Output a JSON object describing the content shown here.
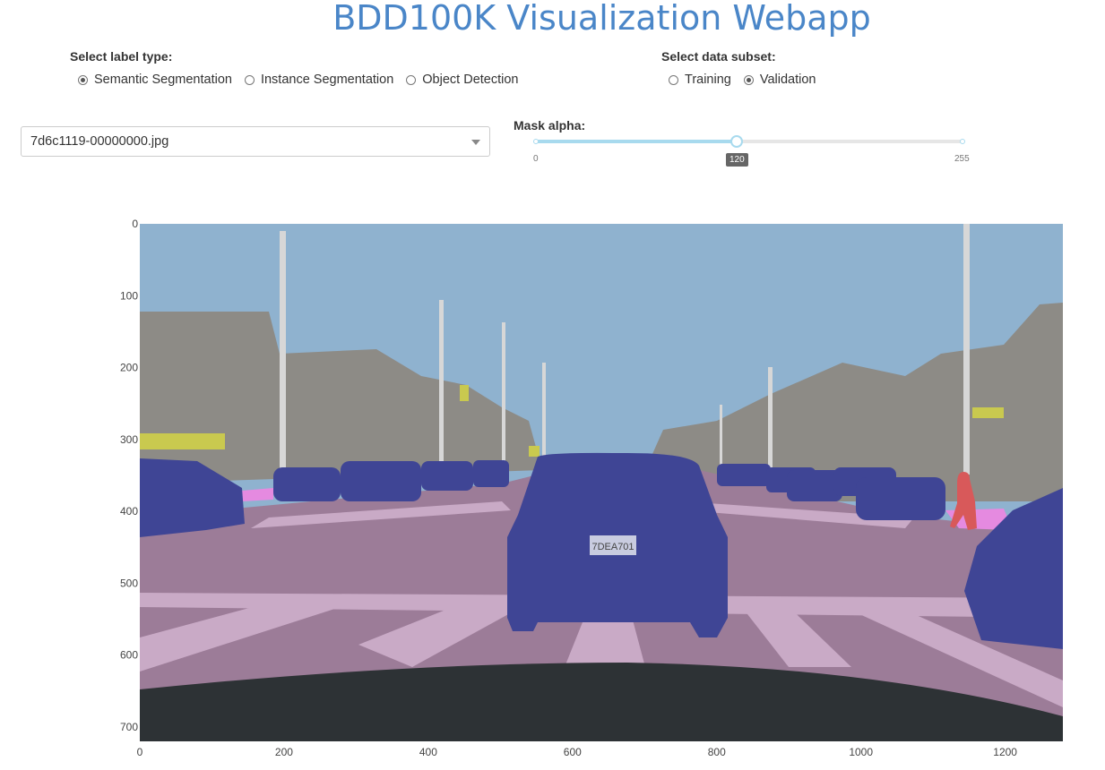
{
  "header": {
    "title": "BDD100K Visualization Webapp"
  },
  "label_type": {
    "label": "Select label type:",
    "options": [
      {
        "label": "Semantic Segmentation",
        "checked": true
      },
      {
        "label": "Instance Segmentation",
        "checked": false
      },
      {
        "label": "Object Detection",
        "checked": false
      }
    ]
  },
  "data_subset": {
    "label": "Select data subset:",
    "options": [
      {
        "label": "Training",
        "checked": false
      },
      {
        "label": "Validation",
        "checked": true
      }
    ]
  },
  "image_select": {
    "value": "7d6c1119-00000000.jpg"
  },
  "mask_alpha": {
    "label": "Mask alpha:",
    "min": 0,
    "max": 255,
    "value": 120,
    "min_label": "0",
    "max_label": "255",
    "value_label": "120"
  },
  "image_plot": {
    "x_ticks": [
      "0",
      "200",
      "400",
      "600",
      "800",
      "1000",
      "1200"
    ],
    "y_ticks": [
      "0",
      "100",
      "200",
      "300",
      "400",
      "500",
      "600",
      "700"
    ],
    "plate_text": "7DEA701",
    "colors": {
      "sky": "#8fb2cf",
      "road": "#9c7c98",
      "crosswalk": "#c9aac6",
      "car": "#3f4595",
      "building": "#8d8b86",
      "sidewalk": "#e58ae0",
      "person": "#d8595a",
      "sign": "#c9c94f",
      "hood": "#2d3235"
    }
  }
}
